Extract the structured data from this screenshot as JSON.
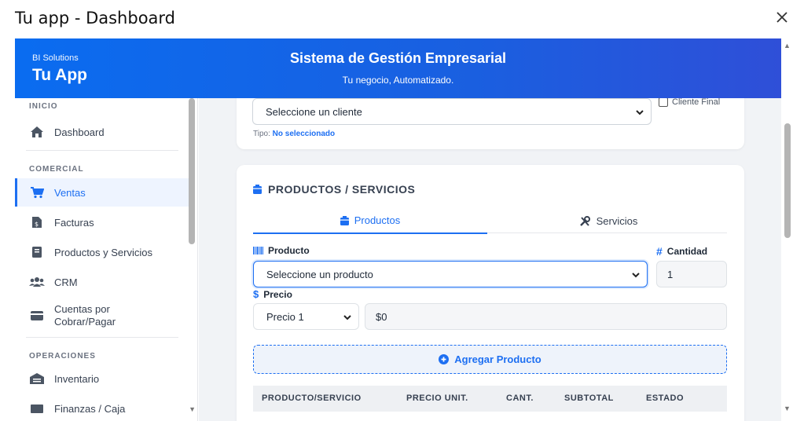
{
  "window": {
    "title": "Tu app - Dashboard"
  },
  "header": {
    "brand_small": "BI Solutions",
    "brand_big": "Tu App",
    "title": "Sistema de Gestión Empresarial",
    "subtitle": "Tu negocio, Automatizado."
  },
  "sidebar": {
    "sections": [
      {
        "label": "INICIO",
        "items": [
          {
            "label": "Dashboard",
            "icon": "home-icon"
          }
        ]
      },
      {
        "label": "COMERCIAL",
        "items": [
          {
            "label": "Ventas",
            "icon": "cart-icon",
            "active": true
          },
          {
            "label": "Facturas",
            "icon": "invoice-icon"
          },
          {
            "label": "Productos y Servicios",
            "icon": "book-icon"
          },
          {
            "label": "CRM",
            "icon": "users-icon"
          },
          {
            "label": "Cuentas por Cobrar/Pagar",
            "icon": "card-icon"
          }
        ]
      },
      {
        "label": "OPERACIONES",
        "items": [
          {
            "label": "Inventario",
            "icon": "warehouse-icon"
          },
          {
            "label": "Finanzas / Caja",
            "icon": "cash-icon"
          }
        ]
      }
    ]
  },
  "client_card": {
    "select_value": "Seleccione un cliente",
    "final_client_label": "Cliente Final",
    "tipo_label": "Tipo:",
    "tipo_value": "No seleccionado"
  },
  "products_card": {
    "heading": "PRODUCTOS / SERVICIOS",
    "tabs": [
      {
        "label": "Productos",
        "active": true
      },
      {
        "label": "Servicios",
        "active": false
      }
    ],
    "product_label": "Producto",
    "product_select": "Seleccione un producto",
    "qty_label": "Cantidad",
    "qty_value": "1",
    "price_label": "Precio",
    "price_select": "Precio 1",
    "price_value": "$0",
    "add_button": "Agregar Producto",
    "columns": [
      "PRODUCTO/SERVICIO",
      "PRECIO UNIT.",
      "CANT.",
      "SUBTOTAL",
      "ESTADO"
    ]
  },
  "colors": {
    "accent": "#1d6ff2",
    "header_start": "#0a6cf0",
    "header_end": "#2f4fd8"
  }
}
